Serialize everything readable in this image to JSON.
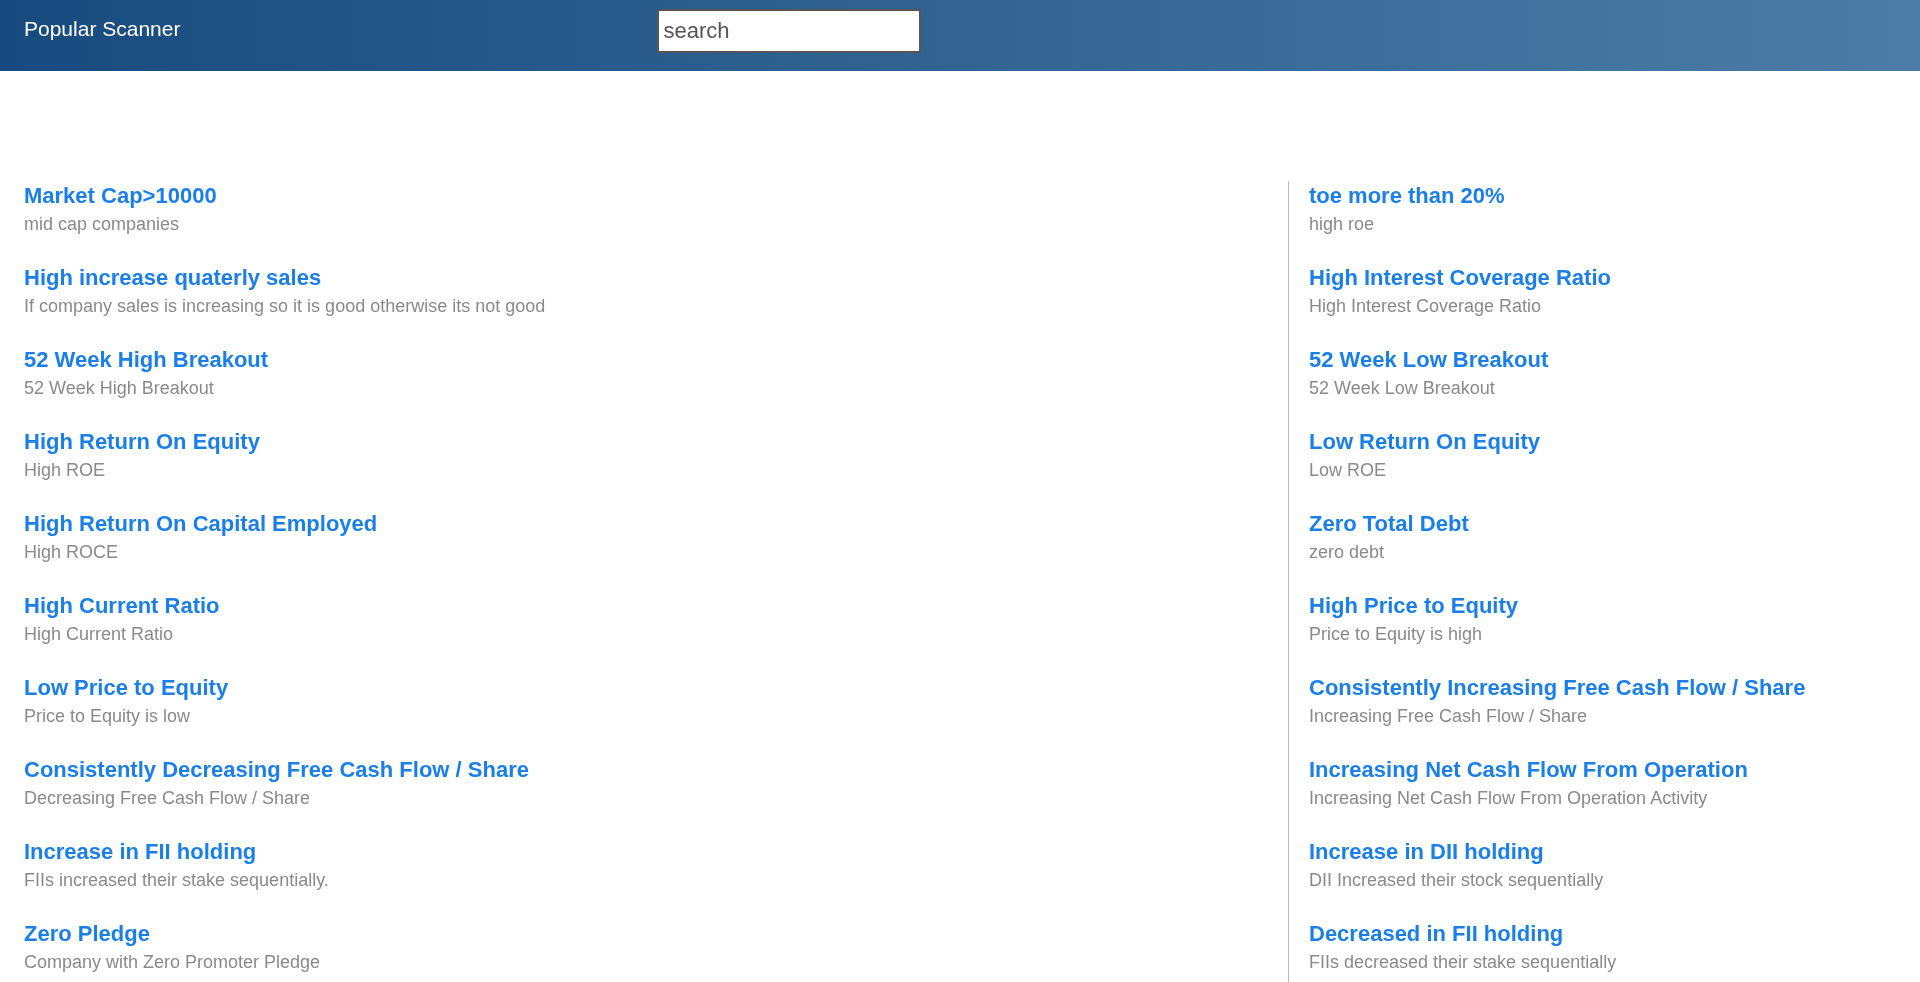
{
  "header": {
    "title": "Popular Scanner",
    "search": {
      "placeholder": "search"
    }
  },
  "columns": [
    [
      {
        "title": "Market Cap>10000",
        "description": "mid cap companies"
      },
      {
        "title": "High increase quaterly sales",
        "description": "If company sales is increasing so it is good otherwise its not good"
      },
      {
        "title": "52 Week High Breakout",
        "description": "52 Week High Breakout"
      },
      {
        "title": "High Return On Equity",
        "description": "High ROE"
      },
      {
        "title": "High Return On Capital Employed",
        "description": "High ROCE"
      },
      {
        "title": "High Current Ratio",
        "description": "High Current Ratio"
      },
      {
        "title": "Low Price to Equity",
        "description": "Price to Equity is low"
      },
      {
        "title": "Consistently Decreasing Free Cash Flow / Share",
        "description": "Decreasing Free Cash Flow / Share"
      },
      {
        "title": "Increase in FII holding",
        "description": "FIIs increased their stake sequentially."
      },
      {
        "title": "Zero Pledge",
        "description": "Company with Zero Promoter Pledge"
      }
    ],
    [
      {
        "title": "toe more than 20%",
        "description": "high roe"
      },
      {
        "title": "High Interest Coverage Ratio",
        "description": "High Interest Coverage Ratio"
      },
      {
        "title": "52 Week Low Breakout",
        "description": "52 Week Low Breakout"
      },
      {
        "title": "Low Return On Equity",
        "description": "Low ROE"
      },
      {
        "title": "Zero Total Debt",
        "description": "zero debt"
      },
      {
        "title": "High Price to Equity",
        "description": "Price to Equity is high"
      },
      {
        "title": "Consistently Increasing Free Cash Flow / Share",
        "description": "Increasing Free Cash Flow / Share"
      },
      {
        "title": "Increasing Net Cash Flow From Operation",
        "description": "Increasing Net Cash Flow From Operation Activity"
      },
      {
        "title": "Increase in DII holding",
        "description": "DII Increased their stock sequentially"
      },
      {
        "title": "Decreased in FII holding",
        "description": "FIIs decreased their stake sequentially"
      }
    ]
  ]
}
